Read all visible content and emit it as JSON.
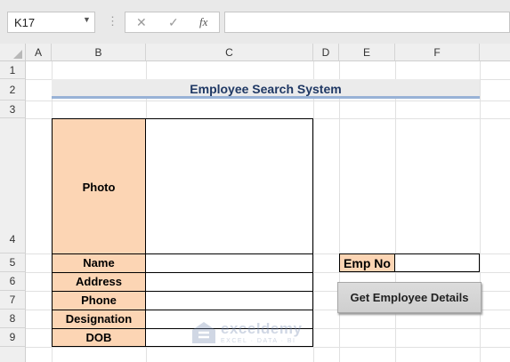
{
  "formula_bar": {
    "name_box": "K17",
    "fx_label": "fx",
    "cancel_icon": "close-icon",
    "enter_icon": "check-icon",
    "formula": ""
  },
  "columns": [
    "A",
    "B",
    "C",
    "D",
    "E",
    "F"
  ],
  "rows": [
    "1",
    "2",
    "3",
    "4",
    "5",
    "6",
    "7",
    "8",
    "9"
  ],
  "sheet": {
    "title": "Employee Search System",
    "fields": [
      {
        "label": "Photo",
        "value": ""
      },
      {
        "label": "Name",
        "value": ""
      },
      {
        "label": "Address",
        "value": ""
      },
      {
        "label": "Phone",
        "value": ""
      },
      {
        "label": "Designation",
        "value": ""
      },
      {
        "label": "DOB",
        "value": ""
      }
    ],
    "emp_no_label": "Emp No",
    "emp_no_value": "",
    "button_label": "Get Employee Details"
  },
  "watermark": {
    "name": "exceldemy",
    "tagline": "EXCEL · DATA · BI"
  },
  "colors": {
    "label_fill": "#fcd5b4",
    "title_text": "#1f3864",
    "title_underline": "#98b2d6"
  }
}
